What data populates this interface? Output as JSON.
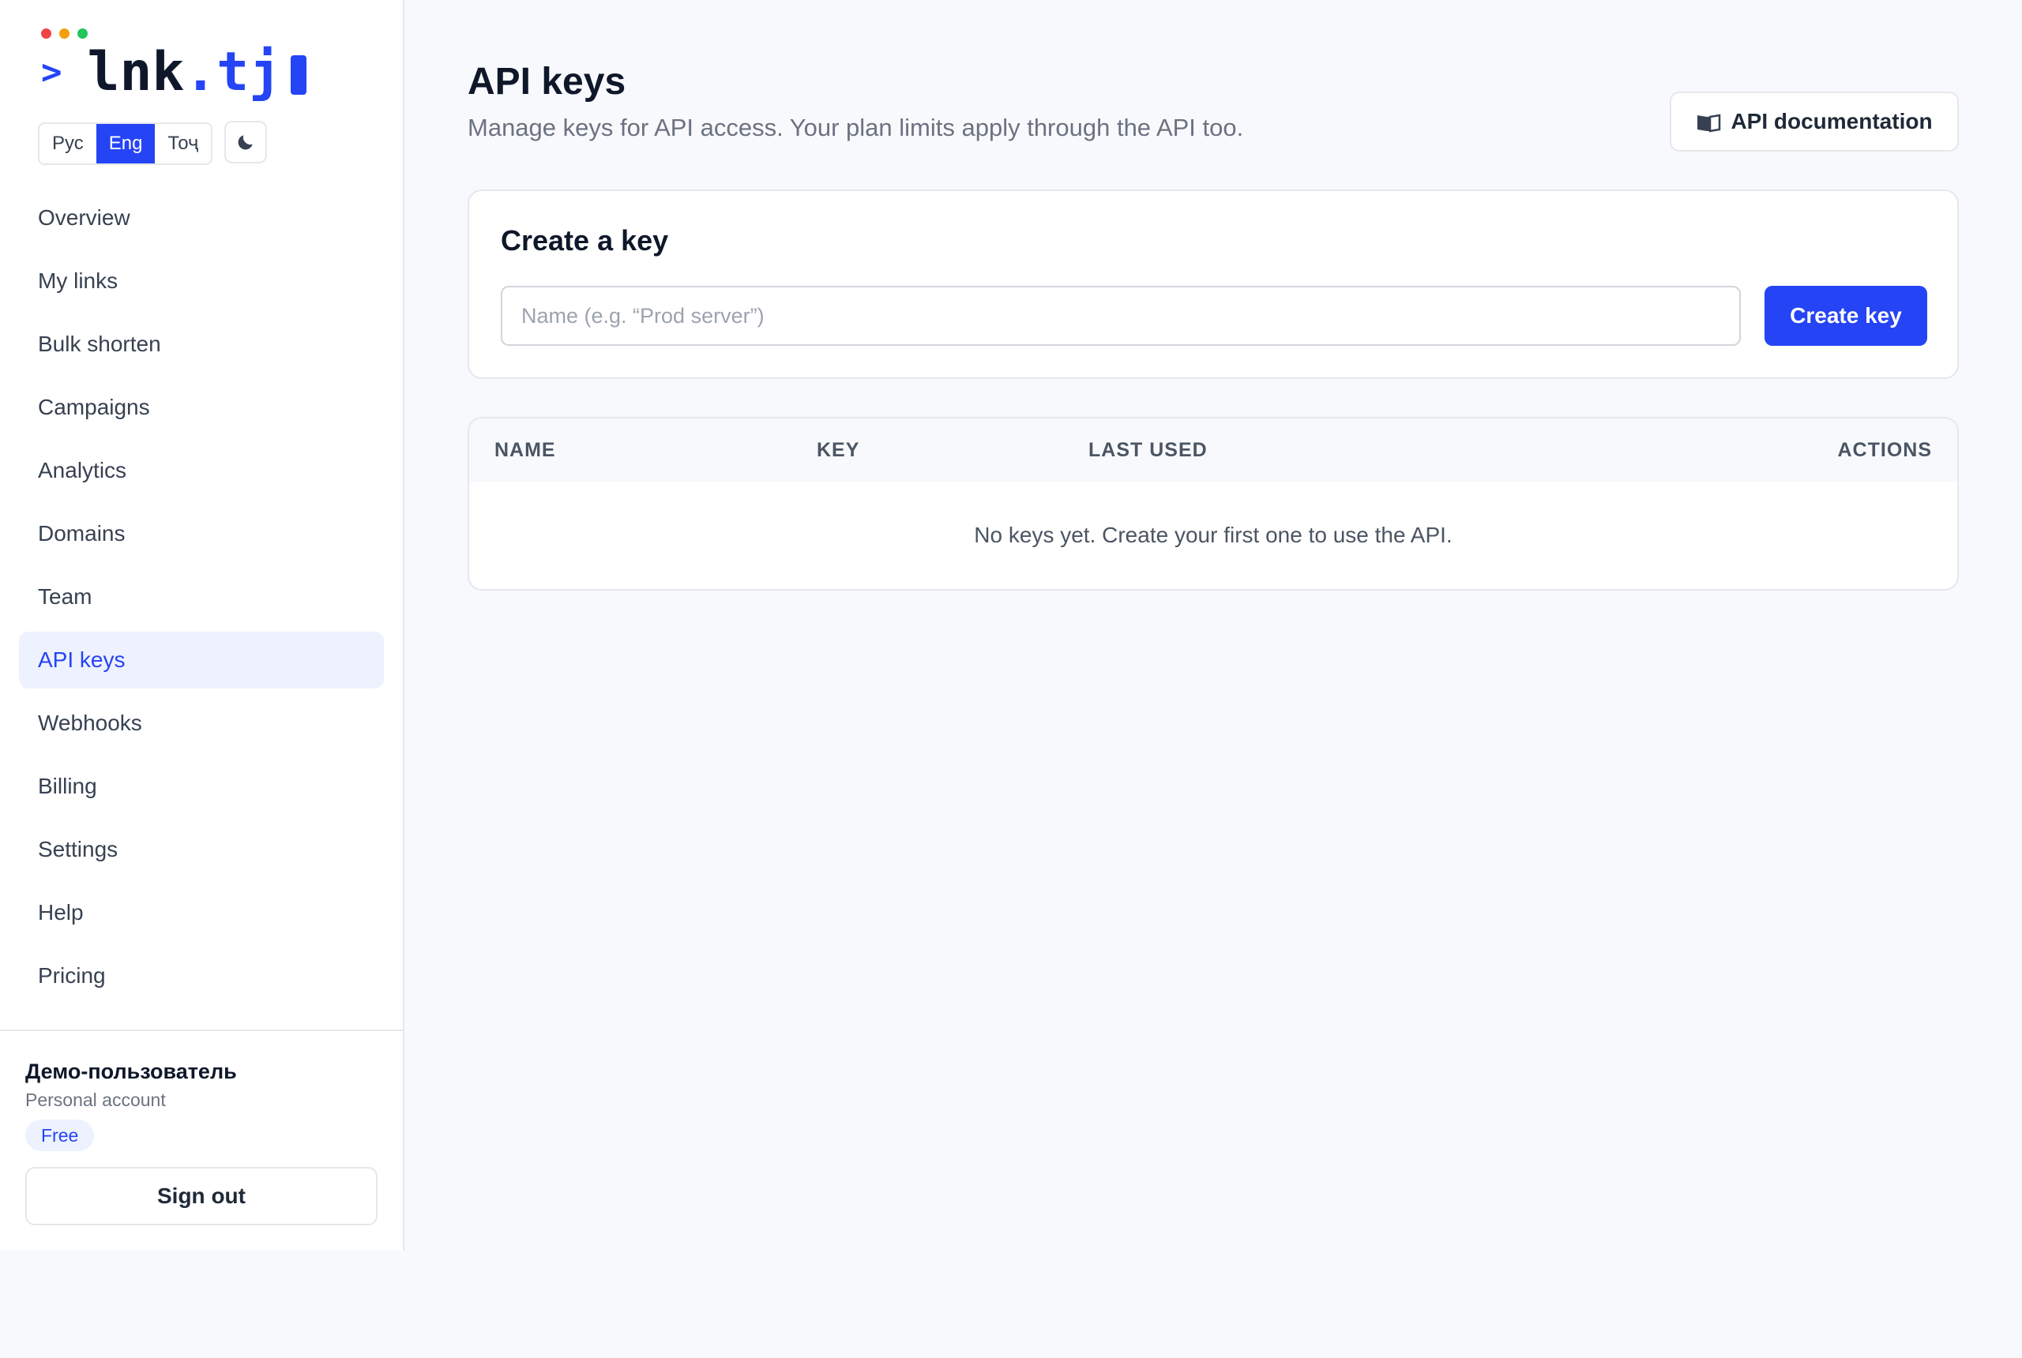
{
  "brand": {
    "caret": ">",
    "name": "lnk",
    "tld": ".tj",
    "dot_colors": [
      "#ef4444",
      "#f59e0b",
      "#22c55e"
    ],
    "accent": "#2544f5"
  },
  "languages": [
    {
      "label": "Рус",
      "active": false
    },
    {
      "label": "Eng",
      "active": true
    },
    {
      "label": "Тоҷ",
      "active": false
    }
  ],
  "theme_toggle": {
    "icon": "moon-icon"
  },
  "nav": [
    {
      "label": "Overview",
      "active": false
    },
    {
      "label": "My links",
      "active": false
    },
    {
      "label": "Bulk shorten",
      "active": false
    },
    {
      "label": "Campaigns",
      "active": false
    },
    {
      "label": "Analytics",
      "active": false
    },
    {
      "label": "Domains",
      "active": false
    },
    {
      "label": "Team",
      "active": false
    },
    {
      "label": "API keys",
      "active": true
    },
    {
      "label": "Webhooks",
      "active": false
    },
    {
      "label": "Billing",
      "active": false
    },
    {
      "label": "Settings",
      "active": false
    },
    {
      "label": "Help",
      "active": false
    },
    {
      "label": "Pricing",
      "active": false
    }
  ],
  "account": {
    "name": "Демо-пользователь",
    "type": "Personal account",
    "plan": "Free",
    "sign_out": "Sign out"
  },
  "header": {
    "title": "API keys",
    "subtitle": "Manage keys for API access. Your plan limits apply through the API too.",
    "docs_button": "API documentation",
    "docs_icon": "book-icon"
  },
  "create_card": {
    "title": "Create a key",
    "input_placeholder": "Name (e.g. “Prod server”)",
    "input_value": "",
    "button": "Create key"
  },
  "table": {
    "columns": [
      "NAME",
      "KEY",
      "LAST USED",
      "ACTIONS"
    ],
    "rows": [],
    "empty_message": "No keys yet. Create your first one to use the API."
  }
}
